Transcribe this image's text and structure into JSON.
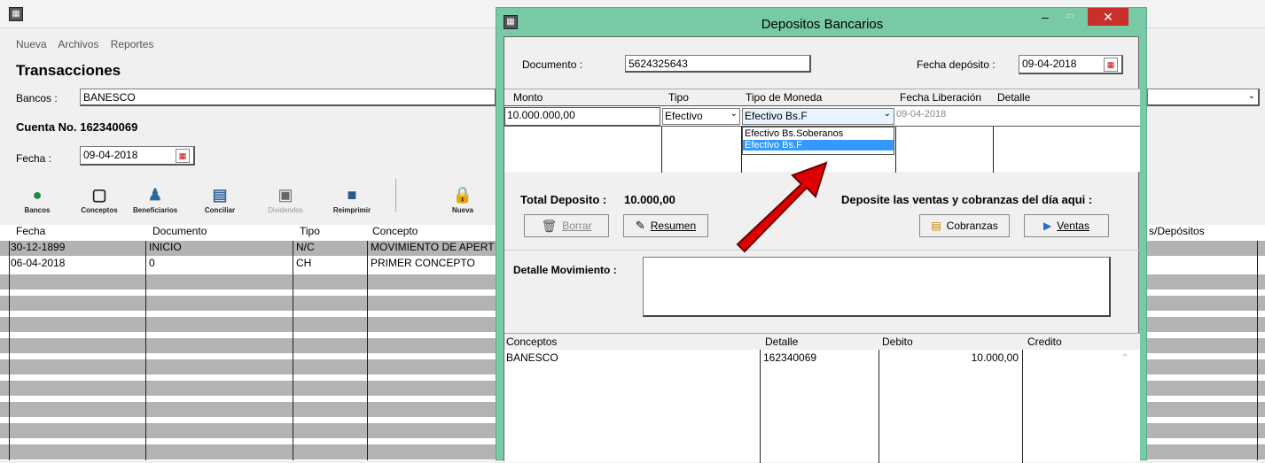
{
  "main": {
    "menu": [
      "Nueva",
      "Archivos",
      "Reportes"
    ],
    "title": "Transacciones",
    "bancos_label": "Bancos :",
    "bancos_value": "BANESCO",
    "cuenta": "Cuenta No. 162340069",
    "fecha_label": "Fecha :",
    "fecha_value": "09-04-2018",
    "toolbar": [
      "Bancos",
      "Conceptos",
      "Beneficiarios",
      "Conciliar",
      "Dividendos",
      "Reimprimir",
      "Nueva"
    ],
    "columns": [
      "Fecha",
      "Documento",
      "Tipo",
      "Concepto"
    ],
    "right_column": "s/Depósitos",
    "rows": [
      {
        "fecha": "30-12-1899",
        "documento": "INICIO",
        "tipo": "N/C",
        "concepto": "MOVIMIENTO DE APERT"
      },
      {
        "fecha": "06-04-2018",
        "documento": "0",
        "tipo": "CH",
        "concepto": "PRIMER CONCEPTO"
      }
    ]
  },
  "dialog": {
    "title": "Depositos Bancarios",
    "documento_label": "Documento :",
    "documento_value": "5624325643",
    "fecha_label": "Fecha depósito :",
    "fecha_value": "09-04-2018",
    "columns": [
      "Monto",
      "Tipo",
      "Tipo de Moneda",
      "Fecha Liberación",
      "Detalle"
    ],
    "monto": "10.000.000,00",
    "tipo": "Efectivo",
    "moneda": "Efectivo Bs.F",
    "moneda_options": [
      "Efectivo Bs.Soberanos",
      "Efectivo Bs.F"
    ],
    "fecha_liberacion": "09-04-2018",
    "total_label": "Total Deposito :",
    "total_value": "10.000,00",
    "deposite_text": "Deposite las ventas y cobranzas del día aqui :",
    "borrar": "Borrar",
    "resumen": "Resumen",
    "cobranzas": "Cobranzas",
    "ventas": "Ventas",
    "detalle_label": "Detalle Movimiento :",
    "bottom_columns": [
      "Conceptos",
      "Detalle",
      "Debito",
      "Credito"
    ],
    "bottom_row": {
      "concepto": "BANESCO",
      "detalle": "162340069",
      "debito": "10.000,00",
      "credito": ""
    }
  },
  "colors": {
    "dialog_frame": "#78c9a6",
    "selection": "#3399ff",
    "arrow": "#e00000",
    "close": "#c9302c"
  }
}
